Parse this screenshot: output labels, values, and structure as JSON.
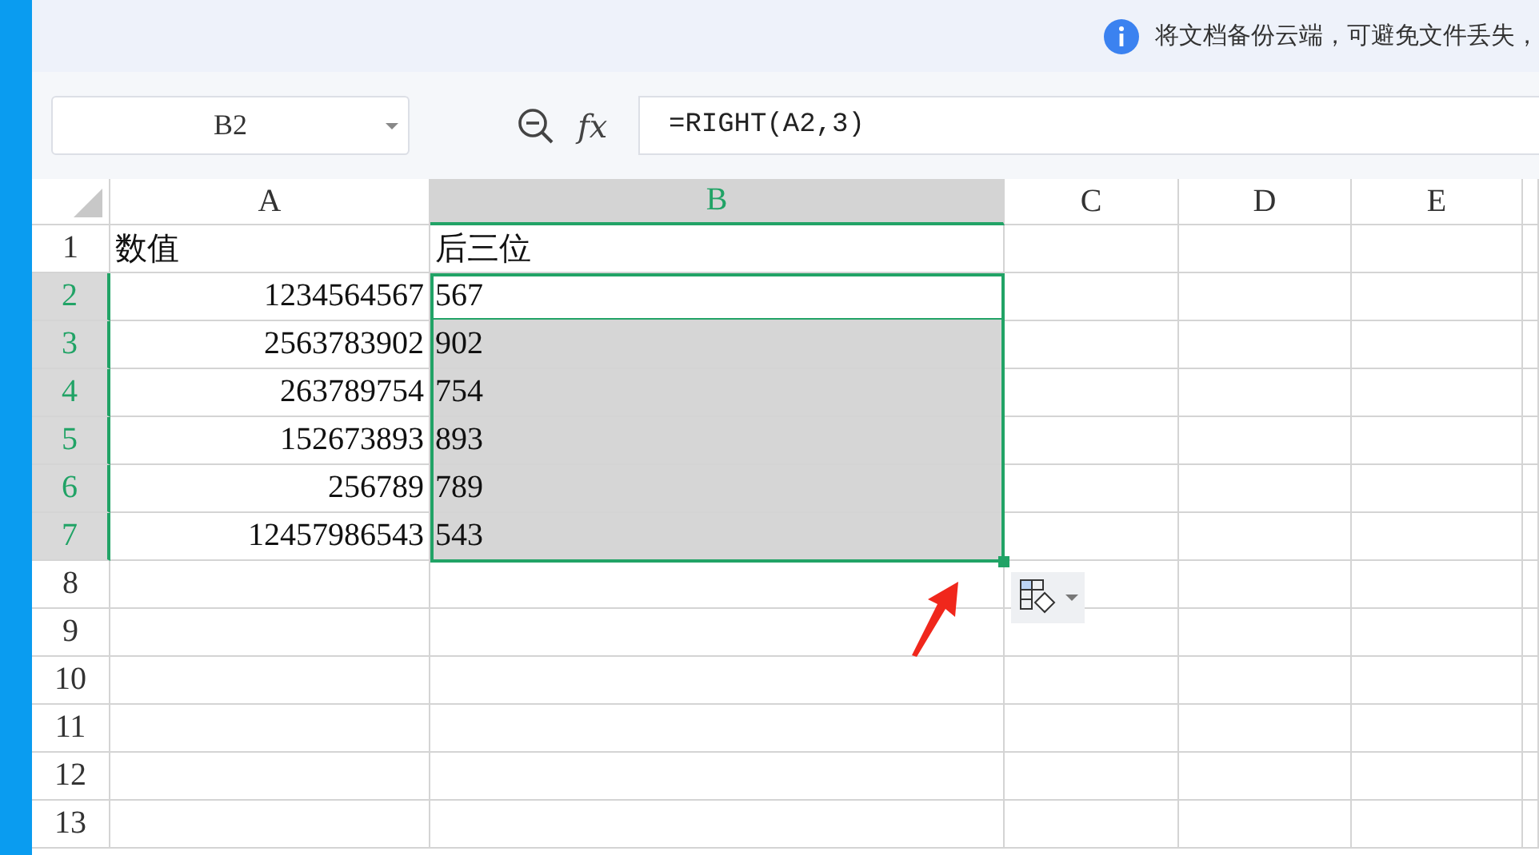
{
  "notice": {
    "text": "将文档备份云端，可避免文件丢失，"
  },
  "name_box": {
    "value": "B2"
  },
  "formula_bar": {
    "fx": "fx",
    "formula": "=RIGHT(A2,3)"
  },
  "columns": [
    {
      "label": "A",
      "selected": false
    },
    {
      "label": "B",
      "selected": true
    },
    {
      "label": "C",
      "selected": false
    },
    {
      "label": "D",
      "selected": false
    },
    {
      "label": "E",
      "selected": false
    }
  ],
  "rows": [
    {
      "number": "1",
      "selected": false,
      "cells": [
        {
          "text": "数值",
          "kind": "text",
          "active": false
        },
        {
          "text": "后三位",
          "kind": "text",
          "active": false
        }
      ]
    },
    {
      "number": "2",
      "selected": true,
      "cells": [
        {
          "text": "1234564567",
          "kind": "number",
          "active": false
        },
        {
          "text": "567",
          "kind": "text",
          "active": true
        }
      ]
    },
    {
      "number": "3",
      "selected": true,
      "cells": [
        {
          "text": "2563783902",
          "kind": "number",
          "active": false
        },
        {
          "text": "902",
          "kind": "text",
          "active": false
        }
      ]
    },
    {
      "number": "4",
      "selected": true,
      "cells": [
        {
          "text": "263789754",
          "kind": "number",
          "active": false
        },
        {
          "text": "754",
          "kind": "text",
          "active": false
        }
      ]
    },
    {
      "number": "5",
      "selected": true,
      "cells": [
        {
          "text": "152673893",
          "kind": "number",
          "active": false
        },
        {
          "text": "893",
          "kind": "text",
          "active": false
        }
      ]
    },
    {
      "number": "6",
      "selected": true,
      "cells": [
        {
          "text": "256789",
          "kind": "number",
          "active": false
        },
        {
          "text": "789",
          "kind": "text",
          "active": false
        }
      ]
    },
    {
      "number": "7",
      "selected": true,
      "cells": [
        {
          "text": "12457986543",
          "kind": "number",
          "active": false
        },
        {
          "text": "543",
          "kind": "text",
          "active": false
        }
      ]
    },
    {
      "number": "8",
      "selected": false
    },
    {
      "number": "9",
      "selected": false
    },
    {
      "number": "10",
      "selected": false
    },
    {
      "number": "11",
      "selected": false
    },
    {
      "number": "12",
      "selected": false
    },
    {
      "number": "13",
      "selected": false
    }
  ]
}
